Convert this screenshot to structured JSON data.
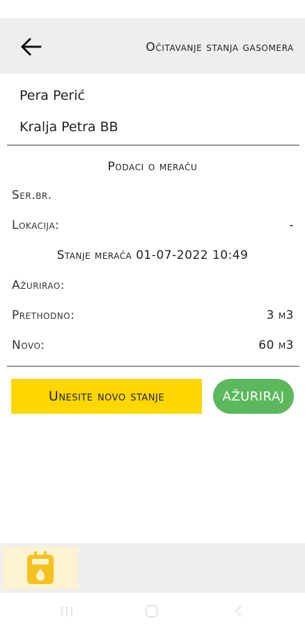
{
  "header": {
    "title": "Očitavanje stanja gasomera",
    "back_icon": "arrow-left-icon"
  },
  "customer": {
    "name": "Pera Perić",
    "address": "Kralja Petra BB"
  },
  "meter": {
    "section_title": "Podaci o meraču",
    "serial_label": "Ser.br.",
    "serial_value": "",
    "location_label": "Lokacija:",
    "location_value": "-",
    "state_text": "Stanje merača 01-07-2022 10:49",
    "updated_by_label": "Ažurirao:",
    "updated_by_value": "",
    "previous_label": "Prethodno:",
    "previous_value": "3 м3",
    "new_label": "Novo:",
    "new_value": "60 м3"
  },
  "actions": {
    "enter_new_state_label": "Unesite novo stanje",
    "update_label": "AŽURIRAJ"
  },
  "bottom_nav": {
    "active_icon": "gas-meter-icon"
  },
  "colors": {
    "yellow_button": "#ffd700",
    "green_button": "#5bb85c",
    "icon_yellow": "#f4c11f",
    "app_bar": "#eeeeee"
  }
}
